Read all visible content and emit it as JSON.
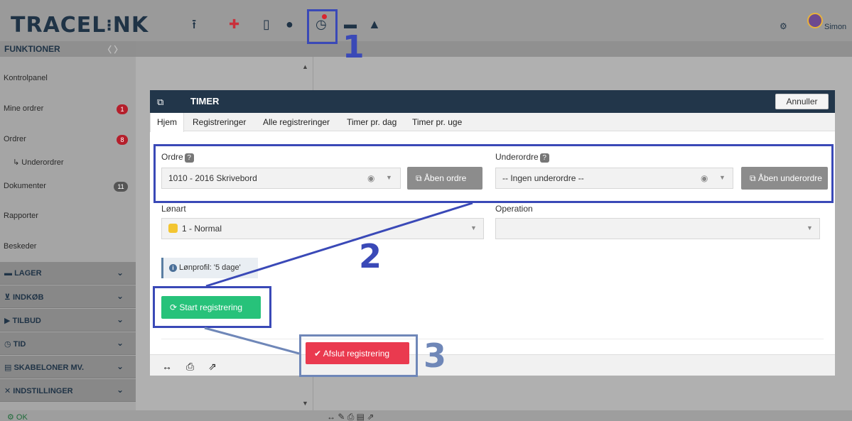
{
  "app": {
    "logo": "TRACEL NK",
    "user_name": "Simon"
  },
  "sidebar": {
    "header": "FUNKTIONER",
    "items": [
      {
        "label": "Kontrolpanel"
      },
      {
        "label": "Mine ordrer",
        "badge": "1"
      },
      {
        "label": "Ordrer",
        "badge": "8"
      },
      {
        "label": "↳ Underordrer"
      },
      {
        "label": "Dokumenter",
        "badge": "11"
      },
      {
        "label": "Rapporter"
      },
      {
        "label": "Beskeder"
      }
    ],
    "sections": [
      {
        "label": "LAGER"
      },
      {
        "label": "INDKØB"
      },
      {
        "label": "TILBUD"
      },
      {
        "label": "TID"
      },
      {
        "label": "SKABELONER MV."
      },
      {
        "label": "INDSTILLINGER"
      }
    ],
    "status": "OK"
  },
  "dialog": {
    "title": "TIMER",
    "cancel_label": "Annuller",
    "tabs": [
      "Hjem",
      "Registreringer",
      "Alle registreringer",
      "Timer pr. dag",
      "Timer pr. uge"
    ],
    "order_label": "Ordre",
    "order_value": "1010 - 2016 Skrivebord",
    "open_order_label": "Åben ordre",
    "suborder_label": "Underordre",
    "suborder_value": "-- Ingen underordre --",
    "open_suborder_label": "Åben underordre",
    "wage_type_label": "Lønart",
    "wage_type_value": "1 - Normal",
    "operation_label": "Operation",
    "operation_value": "",
    "info_text": "Lønprofil: '5 dage'",
    "start_label": "Start registrering",
    "finish_label": "Afslut registrering"
  },
  "annotations": {
    "step1": "1",
    "step2": "2",
    "step3": "3"
  },
  "colors": {
    "header_navy": "#22364a",
    "green_button": "#27c27a",
    "red_button": "#ea3a4f",
    "annotation_blue": "#3a49b7",
    "annotation_light": "#6f87b8"
  }
}
